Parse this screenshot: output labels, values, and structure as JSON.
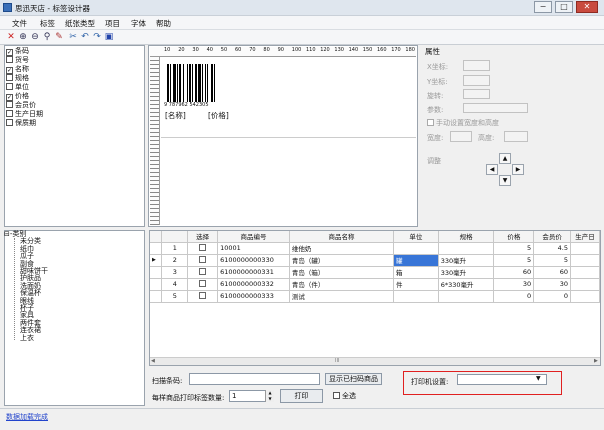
{
  "window": {
    "title": "思迅天店 - 标签设计器",
    "min": "−",
    "max": "□",
    "close": "✕"
  },
  "menu": [
    "文件",
    "标签",
    "纸张类型",
    "项目",
    "字体",
    "帮助"
  ],
  "fields": [
    {
      "label": "条码",
      "checked": true
    },
    {
      "label": "货号",
      "checked": false
    },
    {
      "label": "名称",
      "checked": true
    },
    {
      "label": "规格",
      "checked": false
    },
    {
      "label": "单位",
      "checked": false
    },
    {
      "label": "价格",
      "checked": true
    },
    {
      "label": "会员价",
      "checked": false
    },
    {
      "label": "生产日期",
      "checked": false
    },
    {
      "label": "保质期",
      "checked": false
    }
  ],
  "ruler_marks": [
    "10",
    "20",
    "30",
    "40",
    "50",
    "60",
    "70",
    "80",
    "90",
    "100",
    "110",
    "120",
    "130",
    "140",
    "150",
    "160",
    "170",
    "180"
  ],
  "label_preview": {
    "barcode_text": "9 787962 542305",
    "name": "[名称]",
    "price": "[价格]"
  },
  "props": {
    "title": "属性",
    "x": "X坐标:",
    "y": "Y坐标:",
    "rotate": "旋转:",
    "param": "参数:",
    "manual": "手动设置宽度和高度",
    "width": "宽度:",
    "height": "高度:",
    "adjust": "调整",
    "up": "▲",
    "left": "◀",
    "right": "▶",
    "down": "▼"
  },
  "tree": {
    "root": "类别",
    "items": [
      "未分类",
      "纸巾",
      "瓜子",
      "副食",
      "甜味饼干",
      "护肤品",
      "洗面奶",
      "保温杯",
      "眼线",
      "杯子",
      "家具",
      "两件套",
      "连衣裙",
      "上衣"
    ]
  },
  "table": {
    "headers": [
      "",
      "选择",
      "商品编号",
      "商品名称",
      "单位",
      "规格",
      "价格",
      "会员价",
      "生产日"
    ],
    "rows": [
      {
        "mark": "",
        "n": "1",
        "code": "10001",
        "name": "维他奶",
        "unit": "",
        "spec": "",
        "price": "5",
        "member": "4.5"
      },
      {
        "mark": "▶",
        "n": "2",
        "code": "6100000000330",
        "name": "青岛（罐）",
        "unit": "罐",
        "spec": "330毫升",
        "price": "5",
        "member": "5"
      },
      {
        "mark": "",
        "n": "3",
        "code": "6100000000331",
        "name": "青岛（箱）",
        "unit": "箱",
        "spec": "330毫升",
        "price": "60",
        "member": "60"
      },
      {
        "mark": "",
        "n": "4",
        "code": "6100000000332",
        "name": "青岛（件）",
        "unit": "件",
        "spec": "6*330毫升",
        "price": "30",
        "member": "30"
      },
      {
        "mark": "",
        "n": "5",
        "code": "6100000000333",
        "name": "测试",
        "unit": "",
        "spec": "",
        "price": "0",
        "member": "0"
      }
    ],
    "scroll_mark": "III"
  },
  "bottom": {
    "scan_label": "扫描条码:",
    "show_btn": "显示已扫码商品",
    "printer_label": "打印机设置:",
    "qty_label": "每样商品打印标签数量:",
    "qty_value": "1",
    "print_btn": "打印",
    "select_all": "全选"
  },
  "status": "数据加载完成"
}
